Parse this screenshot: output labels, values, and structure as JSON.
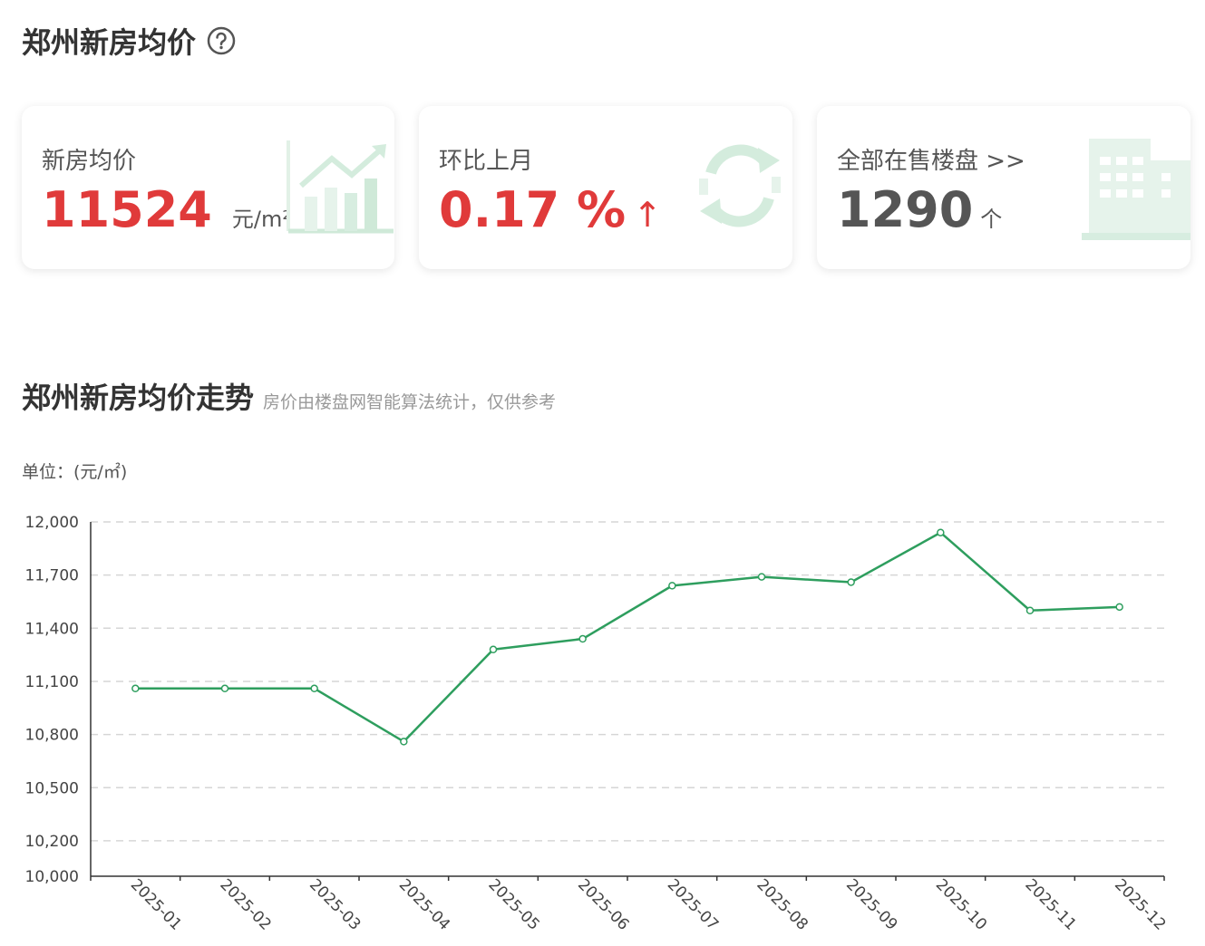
{
  "header": {
    "title": "郑州新房均价",
    "help_icon": "question-circle-icon"
  },
  "cards": [
    {
      "label": "新房均价",
      "value": "11524",
      "unit": "元/m²",
      "icon": "bar-chart-trend-icon"
    },
    {
      "label": "环比上月",
      "value": "0.17 %",
      "trend": "↑",
      "icon": "refresh-cycle-icon"
    },
    {
      "label": "全部在售楼盘 >>",
      "value": "1290",
      "unit": "个",
      "icon": "building-icon"
    }
  ],
  "trend_section": {
    "title": "郑州新房均价走势",
    "subtitle": "房价由楼盘网智能算法统计，仅供参考",
    "unit_label": "单位：(元/㎡)"
  },
  "colors": {
    "accent_red": "#e03a3a",
    "line_green": "#2e9e5e",
    "deco_green": "#cfe9d8"
  },
  "chart_data": {
    "type": "line",
    "categories": [
      "2025-01",
      "2025-02",
      "2025-03",
      "2025-04",
      "2025-05",
      "2025-06",
      "2025-07",
      "2025-08",
      "2025-09",
      "2025-10",
      "2025-11",
      "2025-12"
    ],
    "series": [
      {
        "values": [
          11060,
          11060,
          11060,
          10760,
          11280,
          11340,
          11640,
          11690,
          11660,
          11940,
          11500,
          11520
        ]
      }
    ],
    "yticks": [
      12000,
      11700,
      11400,
      11100,
      10800,
      10500,
      10200,
      10000
    ],
    "ytick_labels": [
      "12,000",
      "11,700",
      "11,400",
      "11,100",
      "10,800",
      "10,500",
      "10,200",
      "10,000"
    ],
    "ylim": [
      10000,
      12000
    ],
    "grid": true
  }
}
